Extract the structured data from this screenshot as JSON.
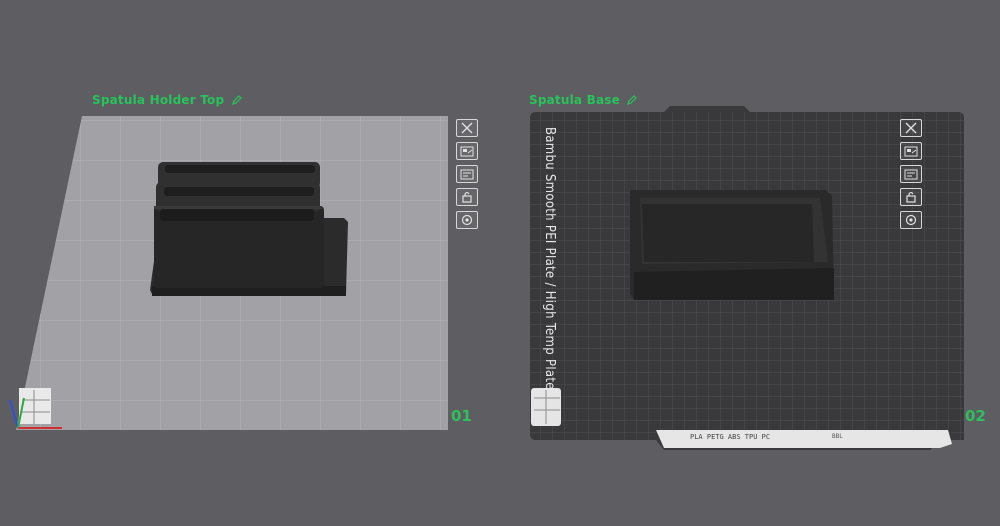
{
  "plates": [
    {
      "name": "Spatula Holder Top",
      "number": "01"
    },
    {
      "name": "Spatula Base",
      "number": "02",
      "surface_text": "Bambu Smooth PEI Plate / High Temp Plate",
      "strip_text": "PLA PETG ABS TPU PC",
      "strip_small_text": "BBL"
    }
  ],
  "tools": [
    "close-icon",
    "arrange-icon",
    "orient-icon",
    "lock-icon",
    "settings-icon"
  ],
  "colors": {
    "background": "#5e5e62",
    "label_green": "#26c45a",
    "plate1_surface": "#a4a4a7",
    "plate2_surface": "#3a3a3c",
    "model": "#2a2a2b"
  }
}
